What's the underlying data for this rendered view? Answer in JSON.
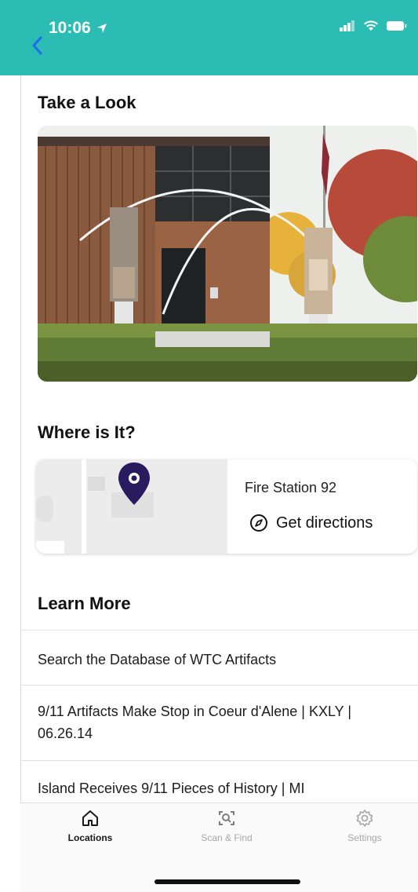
{
  "status": {
    "time": "10:06"
  },
  "sections": {
    "take_a_look": "Take a Look",
    "where_is_it": "Where is It?",
    "learn_more": "Learn More"
  },
  "location": {
    "name": "Fire Station 92",
    "directions_label": "Get directions"
  },
  "learn_more_links": [
    {
      "label": "Search the Database of WTC Artifacts"
    },
    {
      "label": "9/11 Artifacts Make Stop in Coeur d'Alene | KXLY | 06.26.14"
    },
    {
      "label": "Island Receives 9/11 Pieces of History | MI"
    }
  ],
  "tabs": [
    {
      "label": "Locations",
      "icon": "home-icon",
      "active": true
    },
    {
      "label": "Scan & Find",
      "icon": "scan-icon",
      "active": false
    },
    {
      "label": "Settings",
      "icon": "gear-icon",
      "active": false
    }
  ],
  "colors": {
    "header": "#2bbcb3",
    "pin": "#2a1a5e",
    "active_tab": "#1a1a1a",
    "inactive_tab": "#a8a8a8"
  }
}
